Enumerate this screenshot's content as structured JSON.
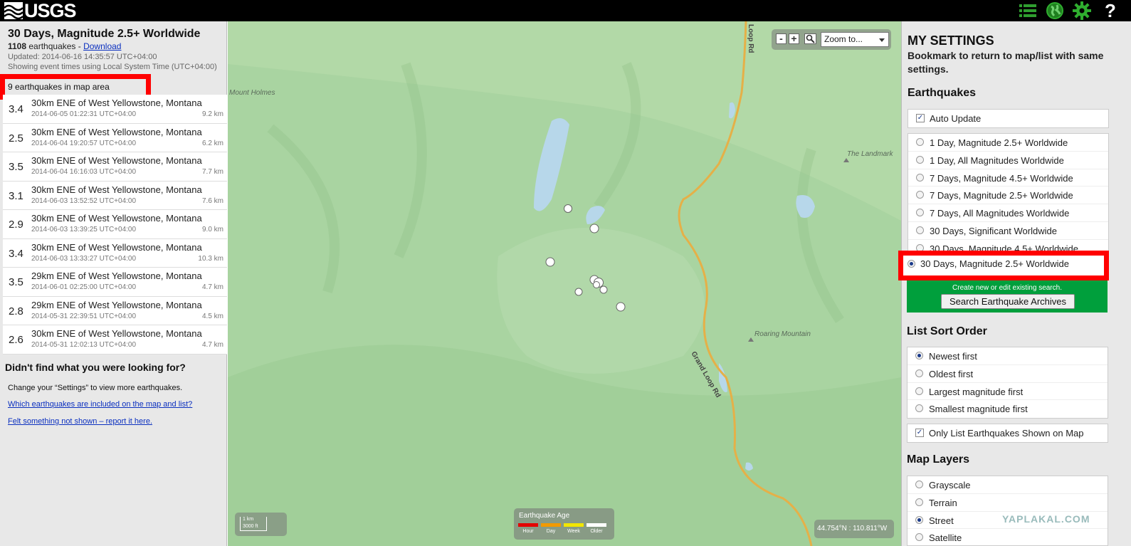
{
  "topbar": {
    "logo_text": "USGS",
    "icons": [
      "list-icon",
      "globe-icon",
      "gear-icon",
      "help-icon"
    ],
    "help_label": "?"
  },
  "feed": {
    "title": "30 Days, Magnitude 2.5+ Worldwide",
    "count": "1108",
    "count_suffix": " earthquakes - ",
    "download_label": "Download",
    "updated": "Updated: 2014-06-16 14:35:57 UTC+04:00",
    "timezone_note": "Showing event times using Local System Time (UTC+04:00)",
    "in_map_area": "9 earthquakes in map area"
  },
  "earthquakes": [
    {
      "mag": "3.4",
      "place": "30km ENE of West Yellowstone, Montana",
      "time": "2014-06-05 01:22:31 UTC+04:00",
      "depth": "9.2 km"
    },
    {
      "mag": "2.5",
      "place": "30km ENE of West Yellowstone, Montana",
      "time": "2014-06-04 19:20:57 UTC+04:00",
      "depth": "6.2 km"
    },
    {
      "mag": "3.5",
      "place": "30km ENE of West Yellowstone, Montana",
      "time": "2014-06-04 16:16:03 UTC+04:00",
      "depth": "7.7 km"
    },
    {
      "mag": "3.1",
      "place": "30km ENE of West Yellowstone, Montana",
      "time": "2014-06-03 13:52:52 UTC+04:00",
      "depth": "7.6 km"
    },
    {
      "mag": "2.9",
      "place": "30km ENE of West Yellowstone, Montana",
      "time": "2014-06-03 13:39:25 UTC+04:00",
      "depth": "9.0 km"
    },
    {
      "mag": "3.4",
      "place": "30km ENE of West Yellowstone, Montana",
      "time": "2014-06-03 13:33:27 UTC+04:00",
      "depth": "10.3 km"
    },
    {
      "mag": "3.5",
      "place": "29km ENE of West Yellowstone, Montana",
      "time": "2014-06-01 02:25:00 UTC+04:00",
      "depth": "4.7 km"
    },
    {
      "mag": "2.8",
      "place": "29km ENE of West Yellowstone, Montana",
      "time": "2014-05-31 22:39:51 UTC+04:00",
      "depth": "4.5 km"
    },
    {
      "mag": "2.6",
      "place": "30km ENE of West Yellowstone, Montana",
      "time": "2014-05-31 12:02:13 UTC+04:00",
      "depth": "4.7 km"
    }
  ],
  "help": {
    "heading": "Didn't find what you were looking for?",
    "change_text": "Change your “Settings” to view more earthquakes.",
    "link1": "Which earthquakes are included on the map and list?",
    "link2": "Felt something not shown – report it here."
  },
  "map": {
    "zoom_minus": "-",
    "zoom_plus": "+",
    "zoom_select": "Zoom to...",
    "labels": {
      "mount_holmes": "Mount Holmes",
      "the_landmark": "The Landmark",
      "roaring_mountain": "Roaring Mountain",
      "loop_rd_top": "Loop Rd",
      "grand_loop_rd": "Grand Loop Rd"
    },
    "scale_km": "1 km",
    "scale_ft": "3000 ft",
    "age_legend": {
      "title": "Earthquake Age",
      "items": [
        {
          "label": "Hour",
          "color": "#e30000"
        },
        {
          "label": "Day",
          "color": "#f29a00"
        },
        {
          "label": "Week",
          "color": "#f2e600"
        },
        {
          "label": "Older",
          "color": "#ffffff"
        }
      ]
    },
    "coords": "44.754°N : 110.811°W",
    "colors": {
      "land": "#a9d4a1",
      "water": "#b7d7ea",
      "road": "#e5b048"
    }
  },
  "settings": {
    "title": "MY SETTINGS",
    "subtitle": "Bookmark to return to map/list with same settings.",
    "earthquakes_heading": "Earthquakes",
    "auto_update": "Auto Update",
    "feeds": [
      "1 Day, Magnitude 2.5+ Worldwide",
      "1 Day, All Magnitudes Worldwide",
      "7 Days, Magnitude 4.5+ Worldwide",
      "7 Days, Magnitude 2.5+ Worldwide",
      "7 Days, All Magnitudes Worldwide",
      "30 Days, Significant Worldwide",
      "30 Days, Magnitude 4.5+ Worldwide",
      "30 Days, Magnitude 2.5+ Worldwide"
    ],
    "selected_feed": "30 Days, Magnitude 2.5+ Worldwide",
    "search_note": "Create new or edit existing search.",
    "search_button": "Search Earthquake Archives",
    "sort_heading": "List Sort Order",
    "sort_options": [
      "Newest first",
      "Oldest first",
      "Largest magnitude first",
      "Smallest magnitude first"
    ],
    "sort_selected": "Newest first",
    "only_list": "Only List Earthquakes Shown on Map",
    "layers_heading": "Map Layers",
    "layers": [
      "Grayscale",
      "Terrain",
      "Street",
      "Satellite"
    ],
    "layer_selected": "Street"
  },
  "watermark": "YAPLAKAL.COM"
}
